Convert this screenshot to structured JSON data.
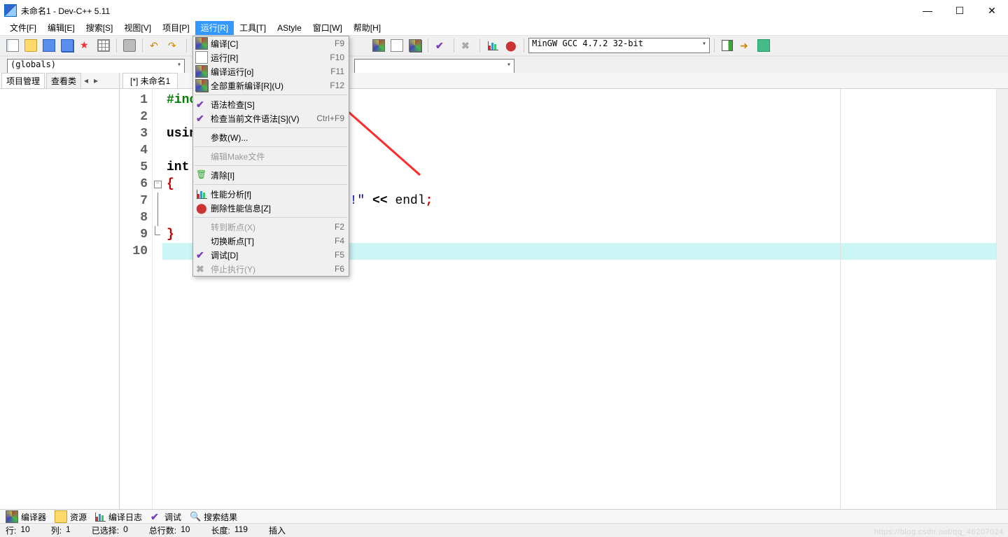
{
  "window": {
    "title": "未命名1 - Dev-C++ 5.11"
  },
  "menubar": {
    "items": [
      {
        "label": "文件[F]"
      },
      {
        "label": "编辑[E]"
      },
      {
        "label": "搜索[S]"
      },
      {
        "label": "视图[V]"
      },
      {
        "label": "项目[P]"
      },
      {
        "label": "运行[R]",
        "active": true
      },
      {
        "label": "工具[T]"
      },
      {
        "label": "AStyle"
      },
      {
        "label": "窗口[W]"
      },
      {
        "label": "帮助[H]"
      }
    ]
  },
  "toolbars": {
    "compiler_select": "MinGW GCC 4.7.2 32-bit",
    "globals_select": "(globals)"
  },
  "left_panel": {
    "tabs": [
      "项目管理",
      "查看类"
    ]
  },
  "editor": {
    "tab_label": "[*] 未命名1",
    "line_numbers": [
      "1",
      "2",
      "3",
      "4",
      "5",
      "6",
      "7",
      "8",
      "9",
      "10"
    ],
    "code": {
      "l1_pre": "#inc",
      "l3_kw": "usin",
      "l5_type": "int",
      "l6": "{",
      "l7_vis_str": "ld!\"",
      "l7_op": " << ",
      "l7_id": "endl",
      "l7_semi": ";",
      "l9": "}"
    }
  },
  "dropdown": {
    "items": [
      {
        "icon": "compile",
        "label": "编译[C]",
        "shortcut": "F9"
      },
      {
        "icon": "run",
        "label": "运行[R]",
        "shortcut": "F10"
      },
      {
        "icon": "compile",
        "label": "编译运行[o]",
        "shortcut": "F11"
      },
      {
        "icon": "rebuild",
        "label": "全部重新编译[R](U)",
        "shortcut": "F12"
      },
      {
        "sep": true
      },
      {
        "icon": "check",
        "label": "语法检查[S]",
        "shortcut": ""
      },
      {
        "icon": "check",
        "label": "检查当前文件语法[S](V)",
        "shortcut": "Ctrl+F9"
      },
      {
        "sep": true
      },
      {
        "icon": "",
        "label": "参数(W)...",
        "shortcut": ""
      },
      {
        "sep": true
      },
      {
        "icon": "",
        "label": "编辑Make文件",
        "shortcut": "",
        "disabled": true
      },
      {
        "sep": true
      },
      {
        "icon": "trash",
        "label": "清除[I]",
        "shortcut": ""
      },
      {
        "sep": true
      },
      {
        "icon": "chart",
        "label": "性能分析[f]",
        "shortcut": ""
      },
      {
        "icon": "bug",
        "label": "删除性能信息[Z]",
        "shortcut": ""
      },
      {
        "sep": true
      },
      {
        "icon": "",
        "label": "转到断点(X)",
        "shortcut": "F2",
        "disabled": true
      },
      {
        "icon": "",
        "label": "切换断点[T]",
        "shortcut": "F4"
      },
      {
        "icon": "check",
        "label": "调试[D]",
        "shortcut": "F5"
      },
      {
        "icon": "x",
        "label": "停止执行(Y)",
        "shortcut": "F6",
        "disabled": true
      }
    ]
  },
  "bottom_tabs": {
    "items": [
      {
        "icon": "compile",
        "label": "编译器"
      },
      {
        "icon": "open",
        "label": "资源"
      },
      {
        "icon": "chart",
        "label": "编译日志"
      },
      {
        "icon": "check",
        "label": "调试"
      },
      {
        "icon": "find",
        "label": "搜索结果"
      }
    ]
  },
  "status": {
    "row_label": "行:",
    "row": "10",
    "col_label": "列:",
    "col": "1",
    "sel_label": "已选择:",
    "sel": "0",
    "total_label": "总行数:",
    "total": "10",
    "len_label": "长度:",
    "len": "119",
    "mode": "插入"
  },
  "watermark": "https://blog.csdn.net/qq_46207024"
}
